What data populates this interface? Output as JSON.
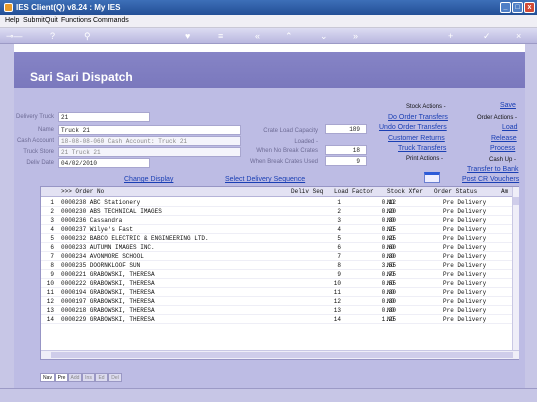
{
  "window": {
    "title": "IES Client(Q) v8.24 : My IES",
    "min": "_",
    "max": "□",
    "close": "x"
  },
  "menu": {
    "items": [
      "Help",
      "Submit",
      "Quit",
      "Functions",
      "Commands"
    ]
  },
  "toolbar": {
    "icons": [
      "back-key-icon",
      "help-icon",
      "search-icon",
      "favorite-icon",
      "menu-icon",
      "first-icon",
      "previous-icon",
      "next-icon",
      "last-icon",
      "add-icon",
      "confirm-icon",
      "close-icon"
    ]
  },
  "screen": {
    "title": "Sari Sari Dispatch"
  },
  "form": {
    "delivery_truck_label": "Delivery Truck",
    "delivery_truck": "21",
    "name_label": "Name",
    "name": "Truck 21",
    "cash_account_label": "Cash Account",
    "cash_account": "18-08-08-060 Cash Account: Truck 21",
    "truck_store_label": "Truck Store",
    "truck_store": "21 Truck 21",
    "deliv_date_label": "Deliv Date",
    "deliv_date": "04/02/2010",
    "crate_load_capacity_label": "Crate Load Capacity",
    "crate_load_capacity": "189",
    "loaded_label": "Loaded -",
    "when_no_break_label": "When No Break Crates",
    "when_no_break": "18",
    "when_break_label": "When Break Crates Used",
    "when_break": "9"
  },
  "stock_actions": {
    "label": "Stock Actions -",
    "do_order": "Do Order Transfers",
    "undo_order": "Undo Order Transfers",
    "customer_returns": "Customer Returns",
    "truck_transfers": "Truck Transfers"
  },
  "order_actions": {
    "save": "Save",
    "label": "Order Actions -",
    "load": "Load",
    "release": "Release",
    "process": "Process"
  },
  "print_actions": {
    "label": "Print Actions -"
  },
  "cash_up": {
    "label": "Cash Up -",
    "transfer": "Transfer to Bank",
    "post_cr": "Post CR Vouchers"
  },
  "links": {
    "change_display": "Change Display",
    "select_sequence": "Select Delivery Sequence"
  },
  "grid": {
    "headers": [
      ">>> Order No",
      "Deliv Seq",
      "Load Factor",
      "Stock Xfer",
      "Order Status",
      "Am"
    ],
    "rows": [
      {
        "n": "1",
        "order": "0000238 ABC Stationery",
        "seq": "1",
        "lf": "0.12",
        "xfer": "NO",
        "status": "Pre Delivery"
      },
      {
        "n": "2",
        "order": "0000230 ABS TECHNICAL IMAGES",
        "seq": "2",
        "lf": "0.20",
        "xfer": "NO",
        "status": "Pre Delivery"
      },
      {
        "n": "3",
        "order": "0000236 Cassandra",
        "seq": "3",
        "lf": "0.30",
        "xfer": "NO",
        "status": "Pre Delivery"
      },
      {
        "n": "4",
        "order": "0000237 Wilye's Fast",
        "seq": "4",
        "lf": "0.25",
        "xfer": "NO",
        "status": "Pre Delivery"
      },
      {
        "n": "5",
        "order": "0000232 BABCO ELECTRIC & ENGINEERING LTD.",
        "seq": "5",
        "lf": "0.25",
        "xfer": "NO",
        "status": "Pre Delivery"
      },
      {
        "n": "6",
        "order": "0000233 AUTUMN IMAGES INC.",
        "seq": "6",
        "lf": "0.60",
        "xfer": "NO",
        "status": "Pre Delivery"
      },
      {
        "n": "7",
        "order": "0000234 AVONMORE SCHOOL",
        "seq": "7",
        "lf": "0.30",
        "xfer": "NO",
        "status": "Pre Delivery"
      },
      {
        "n": "8",
        "order": "0000235 DOORNKLOOF SUN",
        "seq": "8",
        "lf": "3.55",
        "xfer": "NO",
        "status": "Pre Delivery"
      },
      {
        "n": "9",
        "order": "0000221 GRABOWSKI, THERESA",
        "seq": "9",
        "lf": "0.75",
        "xfer": "NO",
        "status": "Pre Delivery"
      },
      {
        "n": "10",
        "order": "0000222 GRABOWSKI, THERESA",
        "seq": "10",
        "lf": "0.55",
        "xfer": "NO",
        "status": "Pre Delivery"
      },
      {
        "n": "11",
        "order": "0000194 GRABOWSKI, THERESA",
        "seq": "11",
        "lf": "0.30",
        "xfer": "NO",
        "status": "Pre Delivery"
      },
      {
        "n": "12",
        "order": "0000197 GRABOWSKI, THERESA",
        "seq": "12",
        "lf": "0.30",
        "xfer": "NO",
        "status": "Pre Delivery"
      },
      {
        "n": "13",
        "order": "0000218 GRABOWSKI, THERESA",
        "seq": "13",
        "lf": "0.30",
        "xfer": "NO",
        "status": "Pre Delivery"
      },
      {
        "n": "14",
        "order": "0000229 GRABOWSKI, THERESA",
        "seq": "14",
        "lf": "1.25",
        "xfer": "NO",
        "status": "Pre Delivery"
      }
    ]
  },
  "tabs": [
    "Nav",
    "Pre",
    "Add",
    "Ins",
    "Ed",
    "Del"
  ]
}
